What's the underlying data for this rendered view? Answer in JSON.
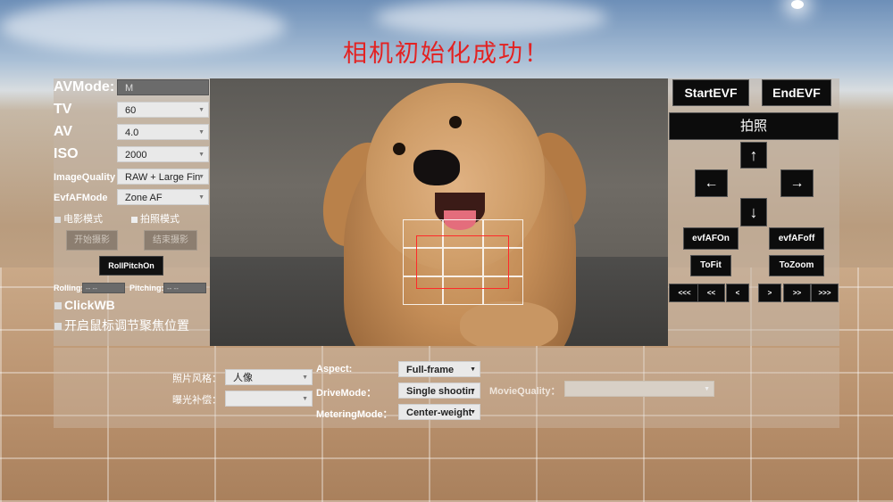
{
  "title": "相机初始化成功！",
  "left": {
    "avmode": {
      "label": "AVMode:",
      "value": "M"
    },
    "tv": {
      "label": "TV",
      "value": "60"
    },
    "av": {
      "label": "AV",
      "value": "4.0"
    },
    "iso": {
      "label": "ISO",
      "value": "2000"
    },
    "image_quality": {
      "label": "ImageQuality",
      "value": "RAW + Large Fin"
    },
    "evfaf_mode": {
      "label": "EvfAFMode",
      "value": "Zone AF"
    },
    "movie_mode": "电影模式",
    "photo_mode": "拍照模式",
    "start_record": "开始摄影",
    "stop_record": "结束摄影",
    "roll_pitch": "RollPitchOn",
    "rolling": {
      "label": "Rolling:",
      "value": "-- --"
    },
    "pitching": {
      "label": "Pitching:",
      "value": "-- --"
    },
    "click_wb": "ClickWB",
    "mouse_focus": "开启鼠标调节聚焦位置"
  },
  "right": {
    "start_evf": "StartEVF",
    "end_evf": "EndEVF",
    "shoot": "拍照",
    "up": "↑",
    "left": "←",
    "right": "→",
    "down": "↓",
    "evfaf_on": "evfAFOn",
    "evfaf_off": "evfAFoff",
    "to_fit": "ToFit",
    "to_zoom": "ToZoom",
    "step_btns": [
      "<<<",
      "<<",
      "<",
      ">",
      ">>",
      ">>>"
    ]
  },
  "bottom": {
    "photo_style": {
      "label": "照片风格：",
      "value": "人像"
    },
    "exposure_comp": {
      "label": "曝光补偿：",
      "value": ""
    },
    "aspect": {
      "label": "Aspect:",
      "value": "Full-frame"
    },
    "drive_mode": {
      "label": "DriveMode：",
      "value": "Single shootin"
    },
    "metering_mode": {
      "label": "MeteringMode：",
      "value": "Center-weight"
    },
    "movie_quality": {
      "label": "MovieQuality：",
      "value": ""
    }
  }
}
